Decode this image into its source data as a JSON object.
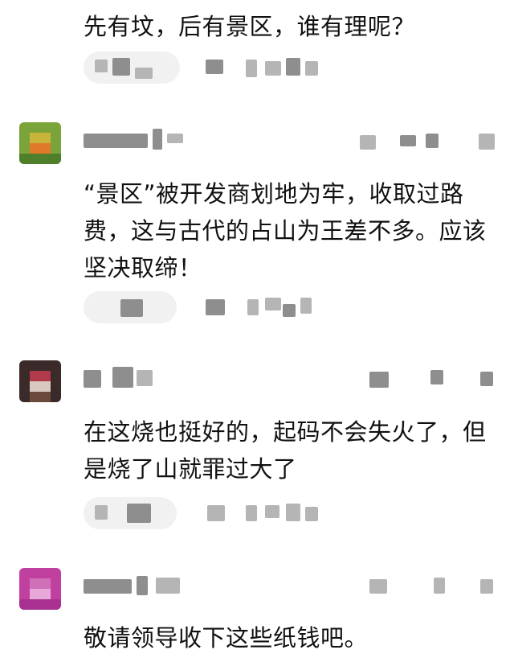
{
  "comments": [
    {
      "text": "先有坟，后有景区，谁有理呢？"
    },
    {
      "text": "“景区”被开发商划地为牢，收取过路费，这与古代的占山为王差不多。应该坚决取缔！"
    },
    {
      "text": "在这烧也挺好的，起码不会失火了，但是烧了山就罪过大了"
    },
    {
      "text": "敬请领导收下这些纸钱吧。"
    }
  ],
  "colors": {
    "avatar_2": [
      "#7aa33a",
      "#c9b43a",
      "#e07a2a",
      "#4f7f2a"
    ],
    "avatar_3": [
      "#3a2a2a",
      "#b03a4a",
      "#d8c8c0",
      "#6a4a3a"
    ],
    "avatar_4": [
      "#c040a0",
      "#d070b8",
      "#e8a8d8",
      "#a83090"
    ]
  },
  "icons": [
    "avatar-icon",
    "like-icon",
    "reply-icon"
  ]
}
